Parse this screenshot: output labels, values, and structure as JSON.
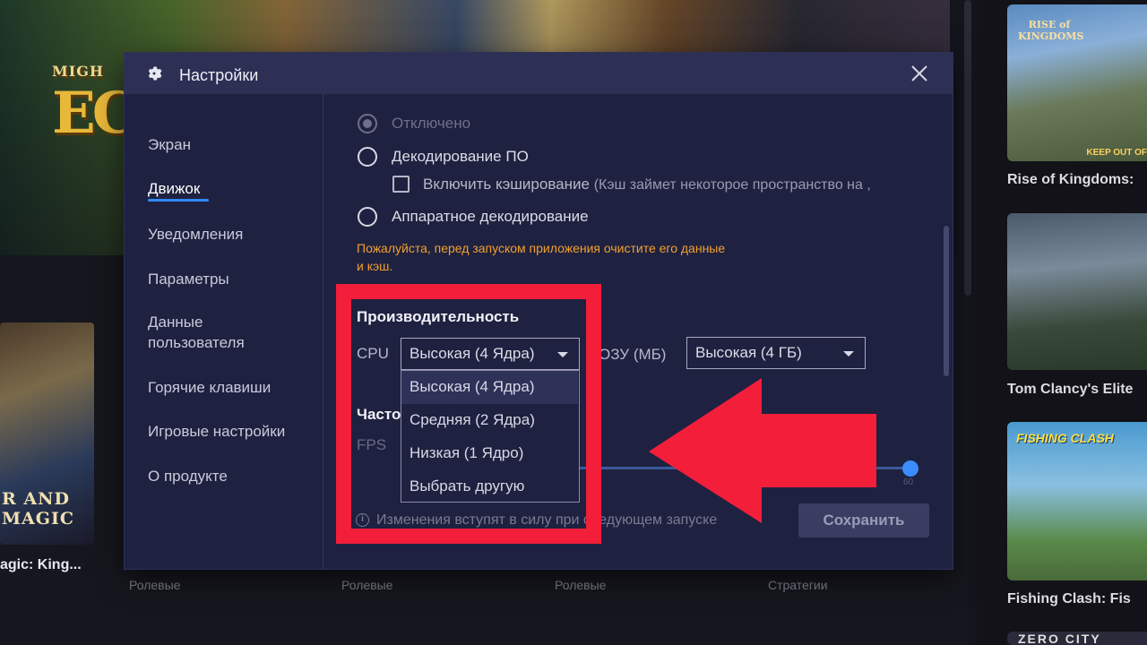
{
  "background": {
    "hero_logo_small": "MIGH",
    "hero_logo_big": "EC",
    "left_tile_text": "R AND MAGIC",
    "left_title": "agic: King...",
    "genres": [
      "Ролевые",
      "Ролевые",
      "Ролевые",
      "Стратегии"
    ],
    "side_games": [
      {
        "title": "Rise of Kingdoms: ",
        "tile_text": "RISE of KINGDOMS",
        "badge": "KEEP OUT OF"
      },
      {
        "title": "Tom Clancy's Elite",
        "tile_text": "",
        "badge": ""
      },
      {
        "title": "Fishing Clash: Fis",
        "tile_text": "FISHING CLASH",
        "badge": ""
      },
      {
        "title": "",
        "tile_text": "ZERO CITY",
        "badge": ""
      }
    ]
  },
  "modal": {
    "title": "Настройки",
    "nav": [
      {
        "label": "Экран",
        "active": false
      },
      {
        "label": "Движок",
        "active": true
      },
      {
        "label": "Уведомления",
        "active": false
      },
      {
        "label": "Параметры",
        "active": false
      },
      {
        "label": "Данные пользователя",
        "active": false
      },
      {
        "label": "Горячие клавиши",
        "active": false
      },
      {
        "label": "Игровые настройки",
        "active": false
      },
      {
        "label": "О продукте",
        "active": false
      }
    ],
    "decoding": {
      "option_disabled": "Отключено",
      "option_software": "Декодирование ПО",
      "cache_label": "Включить кэширование",
      "cache_note": "(Кэш займет некоторое пространство на ,",
      "option_hardware": "Аппаратное декодирование",
      "warning": "Пожалуйста, перед запуском приложения очистите его данные и кэш."
    },
    "performance": {
      "title": "Производительность",
      "cpu_label": "CPU",
      "cpu_value": "Высокая (4 Ядра)",
      "ram_label": "ОЗУ (МБ)",
      "ram_value": "Высокая (4 ГБ)",
      "cpu_options": [
        "Высокая (4 Ядра)",
        "Средняя (2 Ядра)",
        "Низкая (1 Ядро)",
        "Выбрать другую"
      ]
    },
    "frequency": {
      "title": "Часто",
      "fps_label": "FPS",
      "fps_max_label": "60"
    },
    "footer": {
      "info_text": "Изменения вступят в силу при следующем запуске",
      "save_label": "Сохранить"
    }
  },
  "colors": {
    "accent": "#2f8bff",
    "warning": "#f0a030",
    "annotation_red": "#f21e3a"
  }
}
